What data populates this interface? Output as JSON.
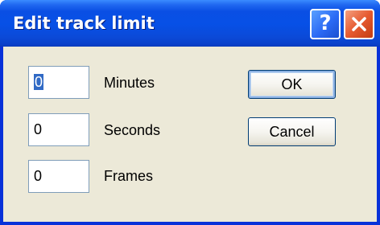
{
  "window": {
    "title": "Edit track limit"
  },
  "title_buttons": {
    "help_glyph": "?",
    "help_icon": "help-icon",
    "close_icon": "close-icon"
  },
  "fields": [
    {
      "value": "0",
      "label": "Minutes",
      "selected": true
    },
    {
      "value": "0",
      "label": "Seconds",
      "selected": false
    },
    {
      "value": "0",
      "label": "Frames",
      "selected": false
    }
  ],
  "buttons": {
    "ok_label": "OK",
    "cancel_label": "Cancel"
  },
  "colors": {
    "titlebar": "#0a4fe4",
    "client": "#ece9d8",
    "close_button": "#e65a30",
    "help_button": "#2b6af5",
    "selection": "#316ac5"
  }
}
